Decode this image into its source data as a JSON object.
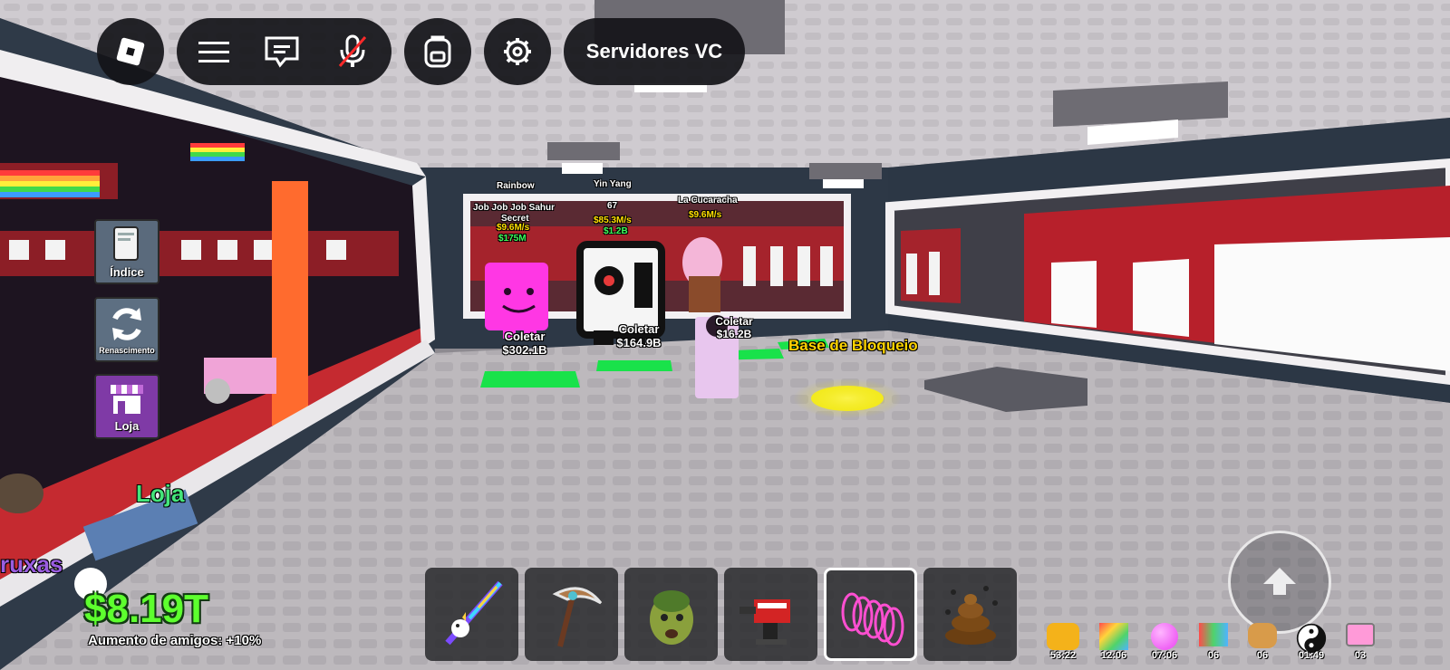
{
  "topbar": {
    "server_button_label": "Servidores VC"
  },
  "side_menu": {
    "index_label": "Índice",
    "rebirth_label": "Renascimento",
    "shop_label": "Loja"
  },
  "world": {
    "shop_sign": "Loja",
    "left_partial_text": "ruxas",
    "base_lock_label": "Base de Bloqueio",
    "brainrots": [
      {
        "mutation": "Rainbow",
        "name": "Job Job Job Sahur",
        "rarity": "Secret",
        "rate": "$9.6M/s",
        "price": "$175M",
        "collect_label": "Coletar",
        "collect_value": "$302.1B"
      },
      {
        "mutation": "Yin Yang",
        "level": "67",
        "rate": "$85.3M/s",
        "price": "$1.2B",
        "collect_label": "Coletar",
        "collect_value": "$164.9B"
      },
      {
        "name": "La Cucaracha",
        "rate": "$9.6M/s",
        "collect_label": "Coletar",
        "collect_value": "$16.2B"
      }
    ]
  },
  "hud": {
    "money": "$8.19T",
    "friends_bonus": "Aumento de amigos: +10%"
  },
  "hotbar": [
    {
      "icon": "unicorn-sword-icon"
    },
    {
      "icon": "scythe-icon"
    },
    {
      "icon": "zombie-head-icon"
    },
    {
      "icon": "red-turret-icon"
    },
    {
      "icon": "pink-coil-icon",
      "selected": true
    },
    {
      "icon": "poop-flies-icon"
    }
  ],
  "buffs": [
    {
      "icon": "golden-cluster-icon",
      "timer": "53:22",
      "color": "#f4b21a"
    },
    {
      "icon": "rainbow-box-icon",
      "timer": "12:06",
      "color": "#6bd3ff"
    },
    {
      "icon": "pink-orb-icon",
      "timer": "07:06",
      "color": "#e93ff0"
    },
    {
      "icon": "pixel-cat-icon",
      "timer": "06",
      "color": "#4fb3ff"
    },
    {
      "icon": "bread-icon",
      "timer": "06",
      "color": "#d89b4a"
    },
    {
      "icon": "yin-yang-icon",
      "timer": "01:49",
      "color": "#111111"
    },
    {
      "icon": "nyan-cat-icon",
      "timer": "03",
      "color": "#ff9ad8"
    }
  ]
}
